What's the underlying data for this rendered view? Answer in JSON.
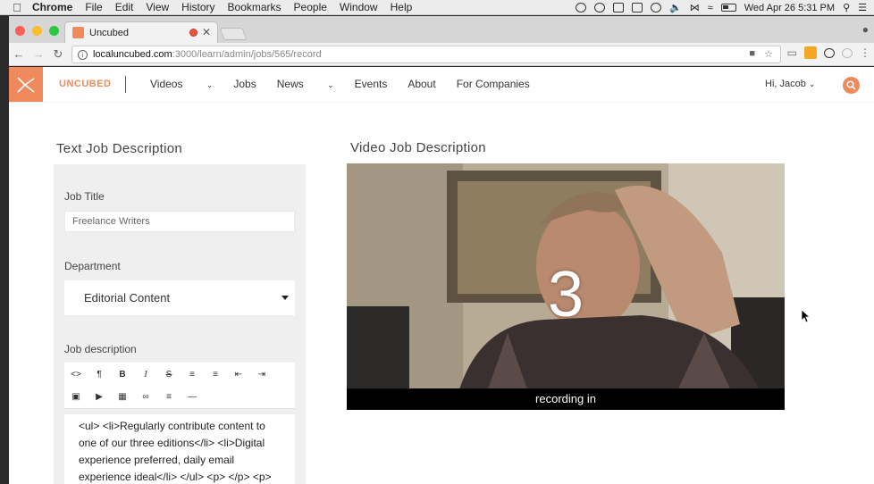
{
  "menubar": {
    "app": "Chrome",
    "items": [
      "File",
      "Edit",
      "View",
      "History",
      "Bookmarks",
      "People",
      "Window",
      "Help"
    ],
    "clock": "Wed Apr 26  5:31 PM"
  },
  "browser": {
    "tab_title": "Uncubed",
    "url_host": "localuncubed.com",
    "url_path": ":3000/learn/admin/jobs/565/record"
  },
  "site": {
    "brand": "UNCUBED",
    "nav": [
      "Videos",
      "Jobs",
      "News",
      "Events",
      "About",
      "For Companies"
    ],
    "greeting": "Hi, Jacob"
  },
  "text_section": {
    "heading": "Text Job Description",
    "job_title_label": "Job Title",
    "job_title_value": "Freelance Writers",
    "department_label": "Department",
    "department_value": "Editorial Content",
    "description_label": "Job description",
    "description_text": "<ul> <li>Regularly contribute content to one of our three editions</li> <li>Digital experience preferred, daily email experience ideal</li> </ul> <p> </p> <p>"
  },
  "video_section": {
    "heading": "Video Job Description",
    "countdown": "3",
    "status": "recording in"
  },
  "colors": {
    "accent": "#f08a5d",
    "panel": "#efefef"
  }
}
